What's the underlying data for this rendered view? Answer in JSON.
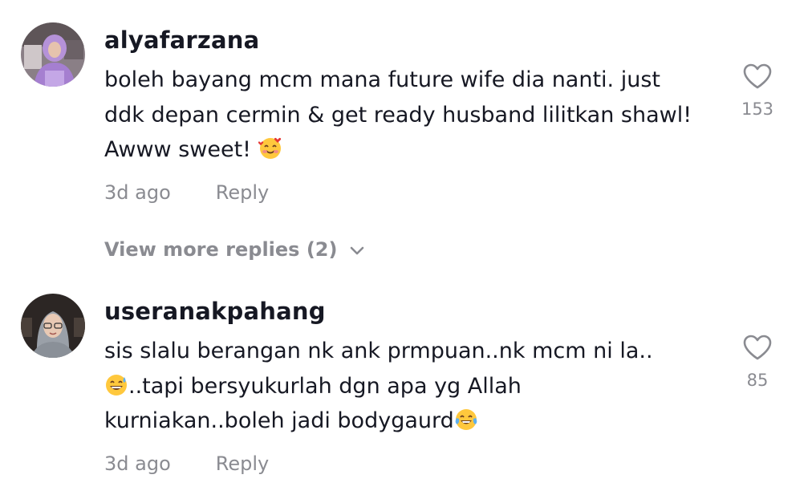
{
  "comments": [
    {
      "username": "alyafarzana",
      "lines": [
        "boleh bayang mcm mana future wife dia nanti. just",
        "ddk depan cermin & get ready husband lilitkan shawl!",
        "Awww sweet! "
      ],
      "emojis": [
        "smiling-face-with-hearts-emoji"
      ],
      "time": "3d ago",
      "reply_label": "Reply",
      "likes": "153",
      "view_more": "View more replies (2)"
    },
    {
      "username": "useranakpahang",
      "lines": [
        "sis slalu berangan nk ank prmpuan..nk mcm ni la..",
        "..tapi bersyukurlah dgn apa yg Allah",
        "kurniakan..boleh jadi bodygaurd"
      ],
      "emojis": [
        "grinning-sweat-emoji",
        "tears-of-joy-emoji"
      ],
      "time": "3d ago",
      "reply_label": "Reply",
      "likes": "85"
    }
  ],
  "colors": {
    "text": "#161823",
    "muted": "#8a8b91",
    "emoji_yellow": "#FFC83D"
  }
}
